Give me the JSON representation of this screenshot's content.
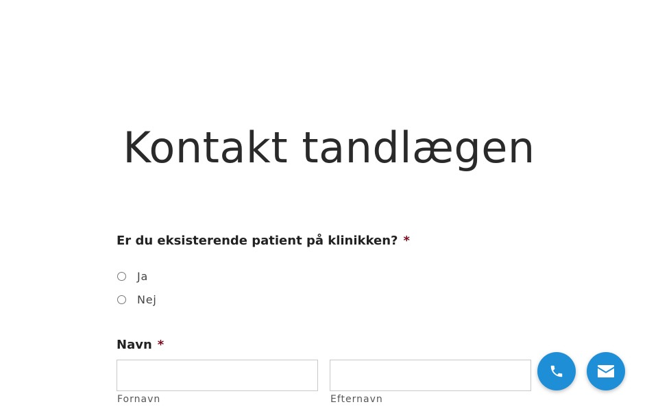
{
  "page": {
    "title": "Kontakt tandlægen"
  },
  "form": {
    "patient_question": {
      "label": "Er du eksisterende patient på klinikken?",
      "required_mark": "*",
      "options": [
        "Ja",
        "Nej"
      ]
    },
    "name": {
      "label": "Navn",
      "required_mark": "*",
      "first_name_value": "",
      "first_name_sublabel": "Fornavn",
      "last_name_value": "",
      "last_name_sublabel": "Efternavn"
    }
  },
  "floating_actions": {
    "color": "#1e8fd6",
    "phone_icon": "phone-icon",
    "mail_icon": "envelope-icon"
  }
}
